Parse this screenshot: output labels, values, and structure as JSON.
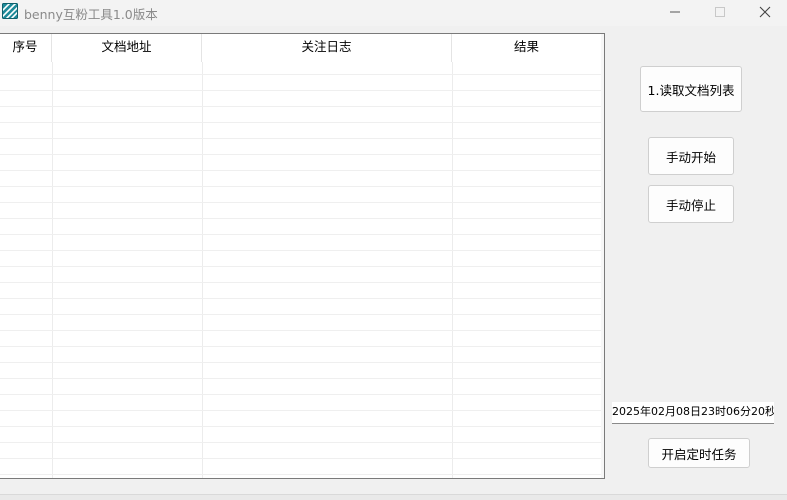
{
  "window": {
    "title": "benny互粉工具1.0版本",
    "icon": "app-logo-icon",
    "controls": [
      "minimize-icon",
      "maximize-icon",
      "close-icon"
    ]
  },
  "grid": {
    "columns": [
      "序号",
      "文档地址",
      "关注日志",
      "结果"
    ],
    "rows": []
  },
  "buttons": {
    "read_list": "1.读取文档列表",
    "manual_start": "手动开始",
    "manual_stop": "手动停止",
    "schedule": "开启定时任务"
  },
  "schedule_time": "2025年02月08日23时06分20秒",
  "colors": {
    "icon_bg": "#1e8a99",
    "window_bg": "#f0f0f0"
  }
}
